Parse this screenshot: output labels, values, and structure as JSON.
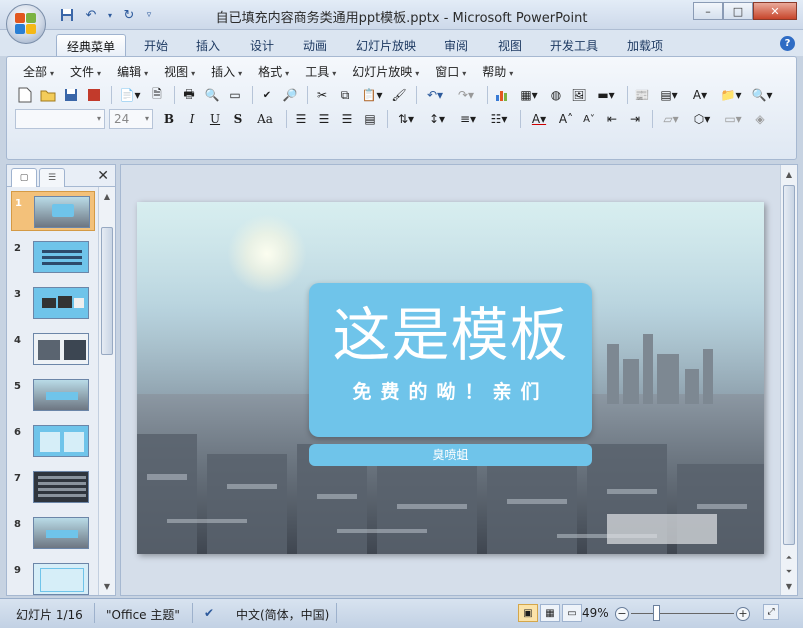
{
  "window": {
    "title": "自已填充内容商务类通用ppt模板.pptx - Microsoft PowerPoint",
    "controls": {
      "minimize": "–",
      "maximize": "□",
      "close": "✕"
    }
  },
  "quick_access": {
    "save_icon": "save-icon",
    "undo_icon": "undo-icon",
    "redo_icon": "redo-icon"
  },
  "tabs": [
    {
      "label": "经典菜单",
      "active": true
    },
    {
      "label": "开始"
    },
    {
      "label": "插入"
    },
    {
      "label": "设计"
    },
    {
      "label": "动画"
    },
    {
      "label": "幻灯片放映"
    },
    {
      "label": "审阅"
    },
    {
      "label": "视图"
    },
    {
      "label": "开发工具"
    },
    {
      "label": "加载项"
    }
  ],
  "help": "?",
  "menus": [
    "全部",
    "文件",
    "编辑",
    "视图",
    "插入",
    "格式",
    "工具",
    "幻灯片放映",
    "窗口",
    "帮助"
  ],
  "font": {
    "name": "",
    "size": "24"
  },
  "format_buttons": {
    "bold": "B",
    "italic": "I",
    "underline": "U",
    "shadow": "S",
    "case": "Aa"
  },
  "slides_pane": {
    "tab_icons": [
      "slides-tab-icon",
      "outline-tab-icon"
    ],
    "close": "✕",
    "slides": [
      {
        "num": "1",
        "selected": true
      },
      {
        "num": "2"
      },
      {
        "num": "3"
      },
      {
        "num": "4"
      },
      {
        "num": "5"
      },
      {
        "num": "6"
      },
      {
        "num": "7"
      },
      {
        "num": "8"
      },
      {
        "num": "9"
      }
    ]
  },
  "slide": {
    "title": "这是模板",
    "subtitle": "免费的呦！亲们",
    "author": "臭喷蛆"
  },
  "status": {
    "slide_count": "幻灯片 1/16",
    "theme": "\"Office 主题\"",
    "language": "中文(简体，中国)",
    "zoom": "49%"
  },
  "colors": {
    "accent_card": "#6fc4ea",
    "selected_thumb": "#f3c17a",
    "ribbon_bg": "#dfe8f3"
  }
}
